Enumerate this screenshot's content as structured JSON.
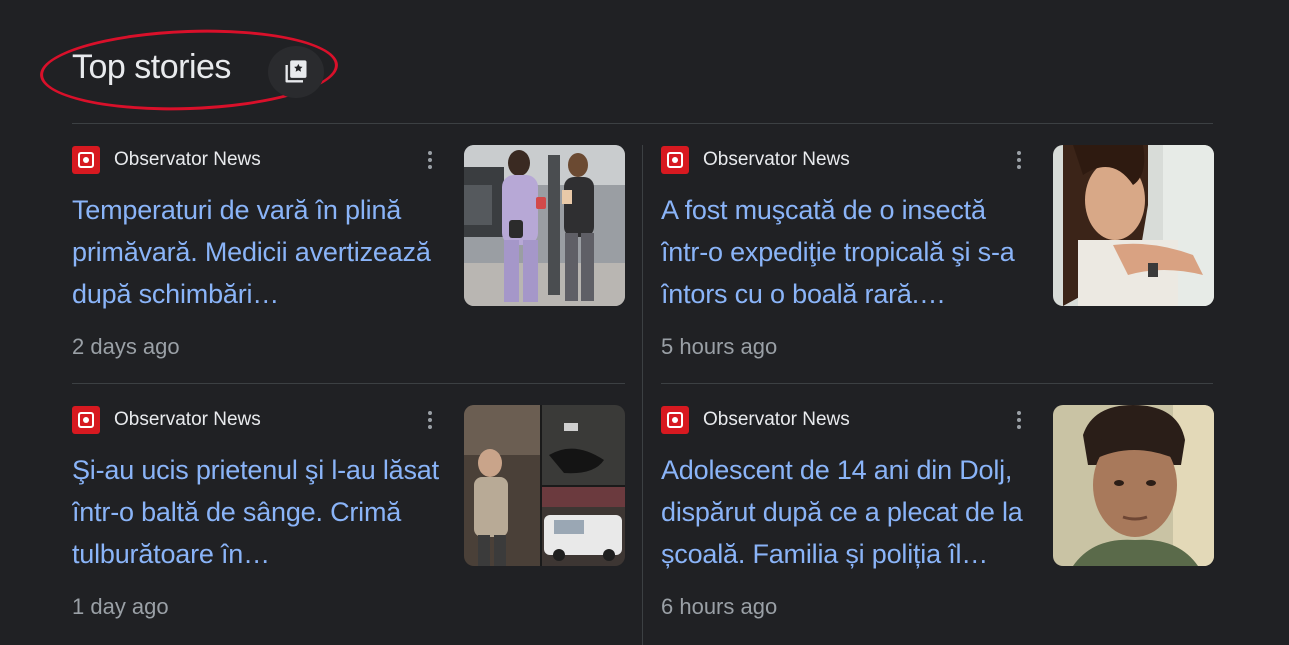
{
  "header": {
    "title": "Top stories"
  },
  "stories": [
    {
      "source": "Observator News",
      "headline": "Temperaturi de vară în plină primăvară. Medicii avertizează după schimbări…",
      "time": "2 days ago"
    },
    {
      "source": "Observator News",
      "headline": "A fost muşcată de o insectă într-o expediţie tropicală şi s-a întors cu o boală rară.…",
      "time": "5 hours ago"
    },
    {
      "source": "Observator News",
      "headline": "Şi-au ucis prietenul şi l-au lăsat într-o baltă de sânge. Crimă tulburătoare în…",
      "time": "1 day ago"
    },
    {
      "source": "Observator News",
      "headline": "Adolescent de 14 ani din Dolj, dispărut după ce a plecat de la școală. Familia și poliția îl…",
      "time": "6 hours ago"
    }
  ],
  "colors": {
    "background": "#202124",
    "headline": "#8ab4f8",
    "source_logo": "#d71920",
    "highlight_ring": "#d9102a"
  }
}
